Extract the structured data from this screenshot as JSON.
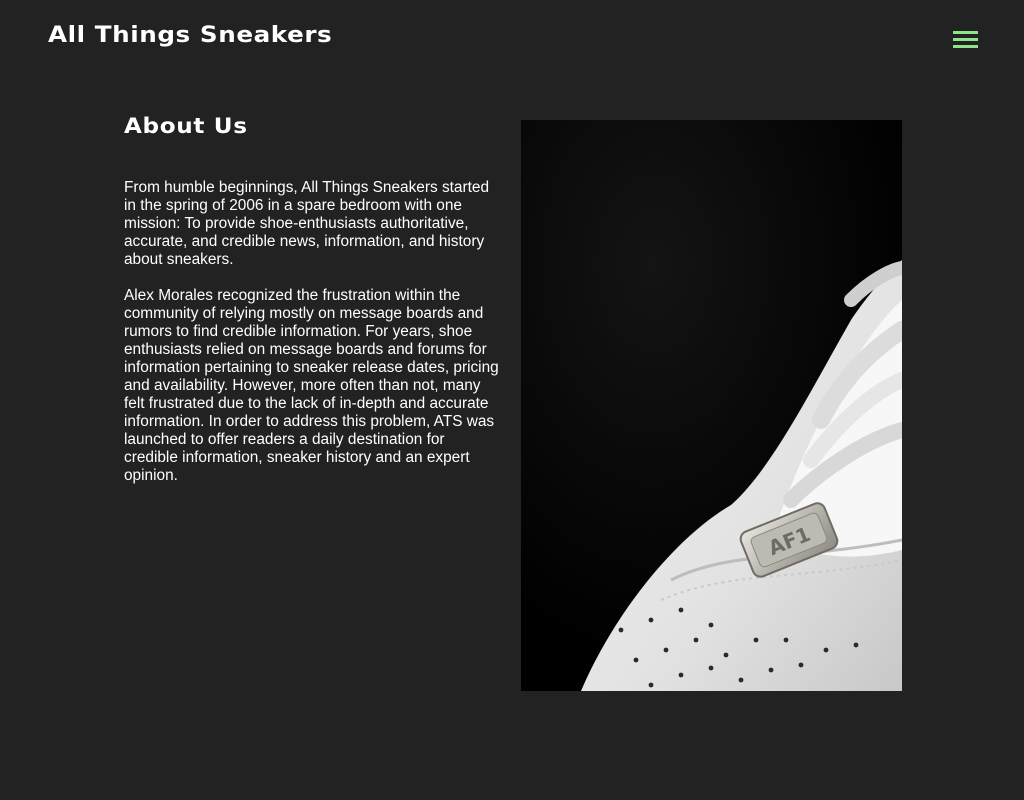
{
  "header": {
    "site_title": "All Things Sneakers",
    "menu_icon": "hamburger-menu-icon",
    "accent_color": "#8fe388"
  },
  "about": {
    "heading": "About Us",
    "paragraphs": [
      "From humble beginnings, All Things Sneakers started in the spring of 2006 in a spare bedroom with one mission: To provide shoe-enthusiasts authoritative, accurate, and credible news, information, and history about sneakers.",
      "Alex Morales recognized the frustration within the community of relying mostly on message boards and rumors to find credible information. For years, shoe enthusiasts relied on message boards and forums for information pertaining to sneaker release dates, pricing and availability. However, more often than not, many felt frustrated due to the lack of in-depth and accurate information. In order to address this problem, ATS was launched to offer readers a daily destination for credible information, sneaker history and an expert opinion."
    ],
    "image_tag_text": "AF1"
  },
  "colors": {
    "background": "#222222",
    "text": "#ffffff"
  }
}
